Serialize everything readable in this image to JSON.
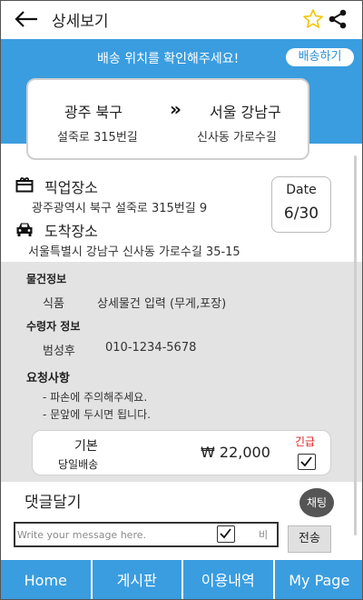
{
  "header": {
    "title": "상세보기"
  },
  "banner": {
    "message": "배송 위치를 확인해주세요!",
    "button_label": "배송하기"
  },
  "route": {
    "from_city": "광주 북구",
    "from_address": "설죽로 315번길",
    "to_city": "서울 강남구",
    "to_address": "신사동 가로수길",
    "arrow": "»"
  },
  "pickup": {
    "title": "픽업장소",
    "address": "광주광역시 북구 설죽로 315번길 9"
  },
  "dropoff": {
    "title": "도착장소",
    "address": "서울특별시 강남구 신사동 가로수길 35-15"
  },
  "date": {
    "label": "Date",
    "value": "6/30"
  },
  "item_info": {
    "heading": "물건정보",
    "category": "식품",
    "detail": "상세물건 입력 (무게,포장)"
  },
  "receiver": {
    "heading": "수령자 정보",
    "name": "범성후",
    "phone": "010-1234-5678"
  },
  "requests": {
    "heading": "요청사항",
    "items": [
      "- 파손에 주의해주세요.",
      "- 문앞에 두시면 됩니다."
    ]
  },
  "price": {
    "type": "기본",
    "sub_type": "당일배송",
    "amount": "₩ 22,000",
    "urgent_label": "긴급",
    "urgent_checked": true
  },
  "comments": {
    "title": "댓글달기",
    "chat_label": "채팅",
    "input_placeholder": "Write your message here.",
    "secret_label": "비",
    "secret_checked": true,
    "send_label": "전송"
  },
  "nav": {
    "items": [
      "Home",
      "게시판",
      "이용내역",
      "My Page"
    ]
  },
  "colors": {
    "primary": "#3a9de0",
    "urgent": "#e02020",
    "star": "#f2c500",
    "info_bg": "#e3e3e3"
  },
  "icons": {
    "back": "arrow-left-icon",
    "favorite": "star-outline-icon",
    "share": "share-icon",
    "pickup": "package-icon",
    "dropoff": "car-icon"
  }
}
